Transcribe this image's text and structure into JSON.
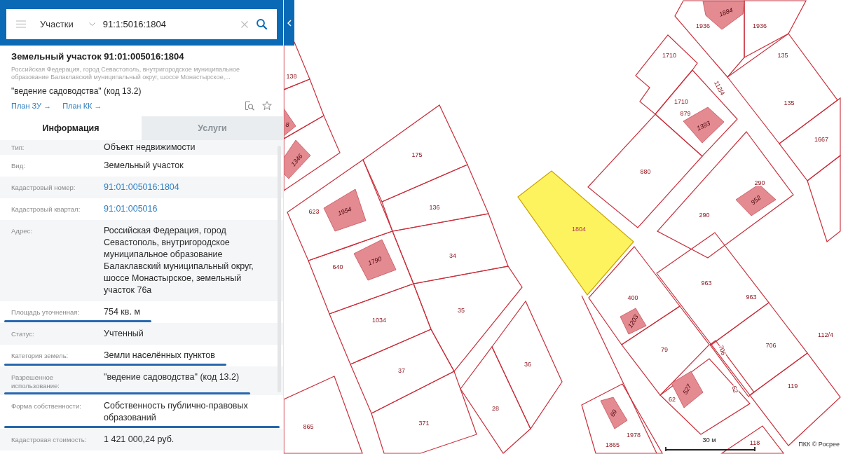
{
  "search": {
    "category": "Участки",
    "query": "91:1:5016:1804"
  },
  "object": {
    "title": "Земельный участок 91:01:005016:1804",
    "address": "Российская Федерация, город Севастополь, внутригородское муниципальное образование Балаклавский муниципальный округ, шоссе Монастырское,...",
    "usage": "\"ведение садоводства\" (код 13.2)",
    "links": [
      "План ЗУ →",
      "План КК →"
    ]
  },
  "tabs": [
    {
      "label": "Информация",
      "selected": true
    },
    {
      "label": "Услуги",
      "selected": false
    }
  ],
  "info_rows": [
    {
      "label": "Тип:",
      "value": "Объект недвижимости",
      "kind": "text",
      "underlined": false
    },
    {
      "label": "Вид:",
      "value": "Земельный участок",
      "kind": "text",
      "underlined": false
    },
    {
      "label": "Кадастровый номер:",
      "value": "91:01:005016:1804",
      "kind": "link",
      "underlined": false
    },
    {
      "label": "Кадастровый квартал:",
      "value": "91:01:005016",
      "kind": "link",
      "underlined": false
    },
    {
      "label": "Адрес:",
      "value": "Российская Федерация, город Севастополь, внутригородское муниципальное образование Балаклавский муниципальный округ, шоссе Монастырское, земельный участок 76а",
      "kind": "text",
      "underlined": false
    },
    {
      "label": "Площадь уточненная:",
      "value": "754 кв. м",
      "kind": "text",
      "underlined": true
    },
    {
      "label": "Статус:",
      "value": "Учтенный",
      "kind": "text",
      "underlined": false
    },
    {
      "label": "Категория земель:",
      "value": "Земли населённых пунктов",
      "kind": "text",
      "underlined": true
    },
    {
      "label": "Разрешенное использование:",
      "value": "\"ведение садоводства\" (код 13.2)",
      "kind": "text",
      "underlined": true
    },
    {
      "label": "Форма собственности:",
      "value": "Собственность публично-правовых образований",
      "kind": "text",
      "underlined": true
    },
    {
      "label": "Кадастровая стоимость:",
      "value": "1 421 000,24 руб.",
      "kind": "text",
      "underlined": false
    }
  ],
  "map": {
    "parcels": [
      {
        "labels": [
          "1936"
        ],
        "selected": false
      },
      {
        "labels": [
          "1936"
        ],
        "selected": false
      },
      {
        "labels": [
          "1710"
        ],
        "selected": false
      },
      {
        "labels": [
          "138"
        ],
        "selected": false
      },
      {
        "labels": [
          "1710",
          "879"
        ],
        "selected": false
      },
      {
        "labels": [
          "135",
          "135"
        ],
        "selected": false
      },
      {
        "labels": [
          "1667"
        ],
        "selected": false
      },
      {
        "labels": [
          "175"
        ],
        "selected": false
      },
      {
        "labels": [
          "880"
        ],
        "selected": false
      },
      {
        "labels": [
          "623"
        ],
        "selected": false
      },
      {
        "labels": [
          "136"
        ],
        "selected": false
      },
      {
        "labels": [
          "290",
          "290"
        ],
        "selected": false
      },
      {
        "labels": [
          "1804"
        ],
        "selected": true
      },
      {
        "labels": [
          "34"
        ],
        "selected": false
      },
      {
        "labels": [
          "640"
        ],
        "selected": false
      },
      {
        "labels": [
          "400"
        ],
        "selected": false
      },
      {
        "labels": [
          "963",
          "963"
        ],
        "selected": false
      },
      {
        "labels": [
          "35"
        ],
        "selected": false
      },
      {
        "labels": [
          "1034"
        ],
        "selected": false
      },
      {
        "labels": [
          "79"
        ],
        "selected": false
      },
      {
        "labels": [
          "706"
        ],
        "selected": false
      },
      {
        "labels": [
          "706"
        ],
        "selected": false
      },
      {
        "labels": [
          "37"
        ],
        "selected": false
      },
      {
        "labels": [
          "36"
        ],
        "selected": false
      },
      {
        "labels": [
          "62",
          "62"
        ],
        "selected": false
      },
      {
        "labels": [
          "119"
        ],
        "selected": false
      },
      {
        "labels": [
          "28"
        ],
        "selected": false
      },
      {
        "labels": [
          "865"
        ],
        "selected": false
      },
      {
        "labels": [
          "371"
        ],
        "selected": false
      },
      {
        "labels": [
          "1978",
          "1865"
        ],
        "selected": false
      },
      {
        "labels": [
          "118"
        ],
        "selected": false
      }
    ],
    "buildings": [
      {
        "label": "1884"
      },
      {
        "label": "8"
      },
      {
        "label": "1393"
      },
      {
        "label": "1346"
      },
      {
        "label": "952"
      },
      {
        "label": "1954"
      },
      {
        "label": "1790"
      },
      {
        "label": "1203"
      },
      {
        "label": "527"
      },
      {
        "label": "69"
      }
    ],
    "road_labels": [
      "112/4",
      "112/4"
    ],
    "scale": "30 м",
    "attribution": "ПКК © Росрее"
  }
}
